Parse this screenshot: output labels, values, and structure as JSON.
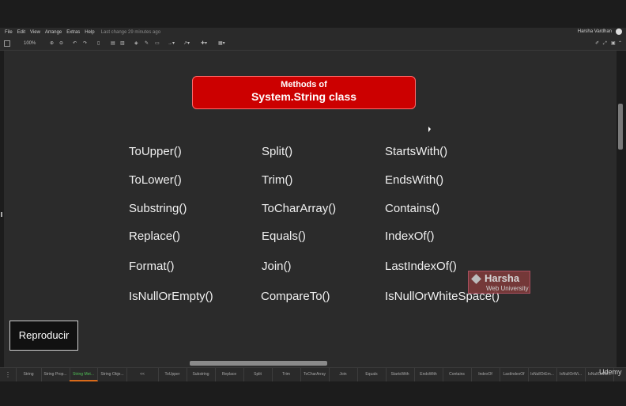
{
  "menu": {
    "items": [
      "File",
      "Edit",
      "View",
      "Arrange",
      "Extras",
      "Help"
    ],
    "last_change": "Last change 29 minutes ago",
    "user": "Harsha Vardhan"
  },
  "toolbar": {
    "zoom": "100%"
  },
  "title": {
    "line1": "Methods of",
    "line2": "System.String class"
  },
  "methods": {
    "col1": [
      "ToUpper()",
      "ToLower()",
      "Substring()",
      "Replace()",
      "Format()",
      "IsNullOrEmpty()"
    ],
    "col2": [
      "Split()",
      "Trim()",
      "ToCharArray()",
      "Equals()",
      "Join()",
      "CompareTo()"
    ],
    "col3": [
      "StartsWith()",
      "EndsWith()",
      "Contains()",
      "IndexOf()",
      "LastIndexOf()",
      "IsNullOrWhiteSpace()"
    ]
  },
  "logo": {
    "brand": "Harsha",
    "sub": "Web University"
  },
  "play_button": "Reproducir",
  "tabs": [
    "String",
    "String Prop...",
    "String Met...",
    "String Obje...",
    "<<",
    "ToUpper",
    "Substring",
    "Replace",
    "Split",
    "Trim",
    "ToCharArray",
    "Join",
    "Equals",
    "StartsWith",
    "EndsWith",
    "Contains",
    "IndexOf",
    "LastIndexOf",
    "IsNullOrEm...",
    "IsNullOrWi...",
    "IsNullOrWi..."
  ],
  "active_tab_index": 2,
  "watermark": "Udemy",
  "colors": {
    "title_bg": "#cc0000",
    "active_tab": "#4fbf55"
  }
}
